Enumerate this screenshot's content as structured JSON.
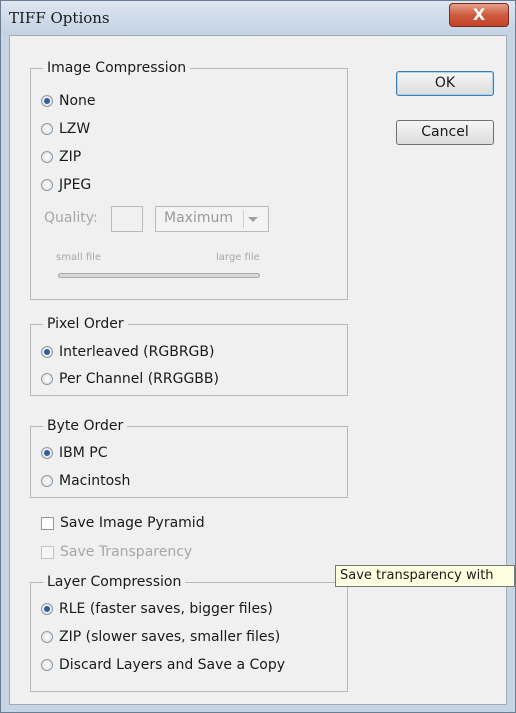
{
  "window": {
    "title": "TIFF Options",
    "close_glyph": "X"
  },
  "buttons": {
    "ok": "OK",
    "cancel": "Cancel"
  },
  "image_compression": {
    "legend": "Image Compression",
    "options": [
      "None",
      "LZW",
      "ZIP",
      "JPEG"
    ],
    "selected": "None",
    "quality_label": "Quality:",
    "quality_value": "",
    "quality_preset": "Maximum",
    "small_file": "small file",
    "large_file": "large file"
  },
  "pixel_order": {
    "legend": "Pixel Order",
    "options": [
      "Interleaved (RGBRGB)",
      "Per Channel (RRGGBB)"
    ],
    "selected": "Interleaved (RGBRGB)"
  },
  "byte_order": {
    "legend": "Byte Order",
    "options": [
      "IBM PC",
      "Macintosh"
    ],
    "selected": "IBM PC"
  },
  "save_image_pyramid": {
    "label": "Save Image Pyramid",
    "checked": false
  },
  "save_transparency": {
    "label": "Save Transparency",
    "checked": false,
    "enabled": false
  },
  "layer_compression": {
    "legend": "Layer Compression",
    "options": [
      "RLE (faster saves, bigger files)",
      "ZIP (slower saves, smaller files)",
      "Discard Layers and Save a Copy"
    ],
    "selected": "RLE (faster saves, bigger files)"
  },
  "tooltip": {
    "text": "Save transparency with"
  },
  "colors": {
    "accent": "#2f5f9f",
    "close_button": "#c2432a",
    "tooltip_bg": "#ffffe1"
  },
  "icons": {
    "close": "close-icon",
    "dropdown": "chevron-down-icon"
  }
}
